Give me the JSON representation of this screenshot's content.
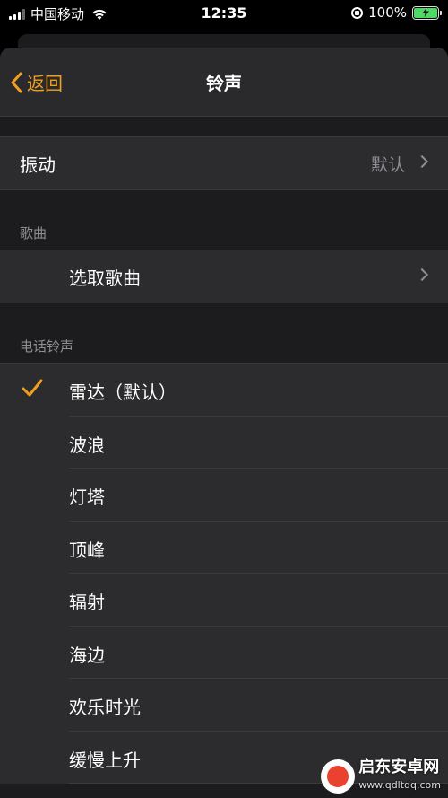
{
  "status_bar": {
    "carrier": "中国移动",
    "time": "12:35",
    "battery": "100%"
  },
  "nav": {
    "back_label": "返回",
    "title": "铃声"
  },
  "vibration": {
    "label": "振动",
    "value": "默认"
  },
  "songs_section": {
    "header": "歌曲",
    "pick_label": "选取歌曲"
  },
  "ringtones_section": {
    "header": "电话铃声",
    "items": [
      {
        "label": "雷达（默认）",
        "selected": true
      },
      {
        "label": "波浪"
      },
      {
        "label": "灯塔"
      },
      {
        "label": "顶峰"
      },
      {
        "label": "辐射"
      },
      {
        "label": "海边"
      },
      {
        "label": "欢乐时光"
      },
      {
        "label": "缓慢上升"
      }
    ]
  },
  "watermark": {
    "name": "启东安卓网",
    "url": "www.qdltdq.com"
  },
  "colors": {
    "accent": "#f0a020",
    "background": "#1c1c1e",
    "row_background": "#2c2c2e"
  }
}
